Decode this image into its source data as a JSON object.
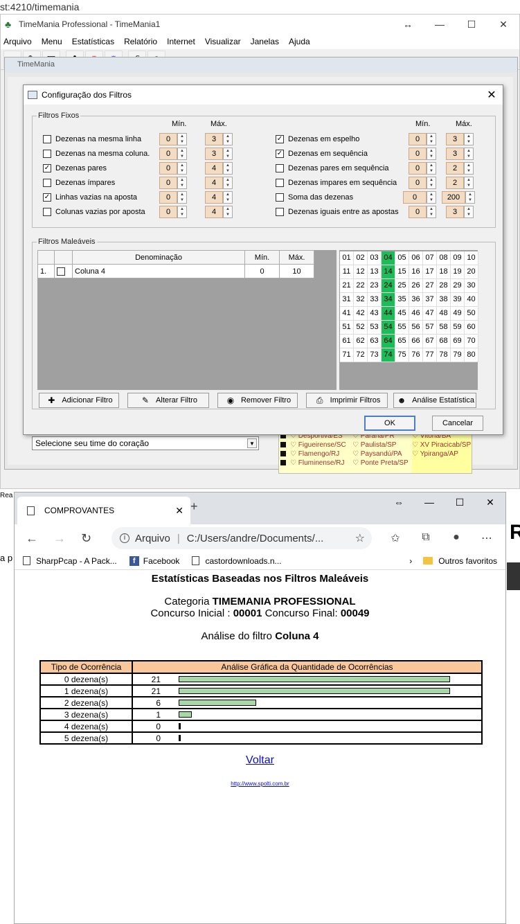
{
  "url_strip": "st:4210/timemania",
  "app": {
    "title": "TimeMania Professional - TimeMania1",
    "menu": [
      "Arquivo",
      "Menu",
      "Estatísticas",
      "Relatório",
      "Internet",
      "Visualizar",
      "Janelas",
      "Ajuda"
    ],
    "mdi_title": "TimeMania",
    "team_select": "Selecione seu time do coração",
    "teams": {
      "col1": [
        "Desportiva/ES",
        "Figueirense/SC",
        "Flamengo/RJ",
        "Fluminense/RJ"
      ],
      "col2": [
        "Paraná/PR",
        "Paulista/SP",
        "Paysandú/PA",
        "Ponte Preta/SP"
      ],
      "col3": [
        "Vitória/BA",
        "XV Piracicab/SP",
        "Ypiranga/AP"
      ]
    }
  },
  "dialog": {
    "title": "Configuração dos Filtros",
    "fixos_legend": "Filtros Fixos",
    "min_label": "Mín.",
    "max_label": "Máx.",
    "left_filters": [
      {
        "label": "Dezenas na mesma linha",
        "checked": false,
        "min": "0",
        "max": "3"
      },
      {
        "label": "Dezenas na mesma coluna.",
        "checked": false,
        "min": "0",
        "max": "3"
      },
      {
        "label": "Dezenas pares",
        "checked": true,
        "min": "0",
        "max": "4"
      },
      {
        "label": "Dezenas ímpares",
        "checked": false,
        "min": "0",
        "max": "4"
      },
      {
        "label": "Linhas vazias na aposta",
        "checked": true,
        "min": "0",
        "max": "4"
      },
      {
        "label": "Colunas vazias por aposta",
        "checked": false,
        "min": "0",
        "max": "4"
      }
    ],
    "right_filters": [
      {
        "label": "Dezenas em espelho",
        "checked": true,
        "min": "0",
        "max": "3"
      },
      {
        "label": "Dezenas em  sequência",
        "checked": true,
        "min": "0",
        "max": "3"
      },
      {
        "label": "Dezenas pares em sequência",
        "checked": false,
        "min": "0",
        "max": "2"
      },
      {
        "label": "Dezenas  impares em sequência",
        "checked": false,
        "min": "0",
        "max": "2"
      },
      {
        "label": "Soma das dezenas",
        "checked": false,
        "min": "0",
        "max": "200"
      },
      {
        "label": "Dezenas iguais entre as apostas",
        "checked": false,
        "min": "0",
        "max": "3"
      }
    ],
    "maleaveis_legend": "Filtros Maleáveis",
    "table_headers": {
      "denom": "Denominação",
      "min": "Mín.",
      "max": "Máx."
    },
    "table_rows": [
      {
        "idx": "1.",
        "name": "Coluna 4",
        "min": "0",
        "max": "10"
      }
    ],
    "highlighted": [
      "04",
      "14",
      "24",
      "34",
      "44",
      "54",
      "64",
      "74"
    ],
    "numbers": [
      "01",
      "02",
      "03",
      "04",
      "05",
      "06",
      "07",
      "08",
      "09",
      "10",
      "11",
      "12",
      "13",
      "14",
      "15",
      "16",
      "17",
      "18",
      "19",
      "20",
      "21",
      "22",
      "23",
      "24",
      "25",
      "26",
      "27",
      "28",
      "29",
      "30",
      "31",
      "32",
      "33",
      "34",
      "35",
      "36",
      "37",
      "38",
      "39",
      "40",
      "41",
      "42",
      "43",
      "44",
      "45",
      "46",
      "47",
      "48",
      "49",
      "50",
      "51",
      "52",
      "53",
      "54",
      "55",
      "56",
      "57",
      "58",
      "59",
      "60",
      "61",
      "62",
      "63",
      "64",
      "65",
      "66",
      "67",
      "68",
      "69",
      "70",
      "71",
      "72",
      "73",
      "74",
      "75",
      "76",
      "77",
      "78",
      "79",
      "80"
    ],
    "buttons": {
      "add": "Adicionar Filtro",
      "edit": "Alterar Filtro",
      "remove": "Remover Filtro",
      "print": "Imprimir Filtros",
      "stats": "Análise Estatística",
      "ok": "OK",
      "cancel": "Cancelar"
    }
  },
  "browser": {
    "tab_title": "COMPROVANTES",
    "url_label": "Arquivo",
    "url": "C:/Users/andre/Documents/...",
    "bookmarks": [
      "SharpPcap - A Pack...",
      "Facebook",
      "castordownloads.n..."
    ],
    "other_bookmarks": "Outros favoritos",
    "report": {
      "heading": "Estatísticas Baseadas nos Filtros Maleáveis",
      "categoria_label": "Categoria",
      "categoria": "TIMEMANIA PROFESSIONAL",
      "inicial_label": "Concurso Inicial :",
      "inicial": "00001",
      "final_label": "Concurso Final:",
      "final": "00049",
      "analise_label": "Análise do filtro",
      "analise": "Coluna 4",
      "col_tipo": "Tipo de Ocorrência",
      "col_grafico": "Análise Gráfica da Quantidade de Ocorrências",
      "rows": [
        {
          "tipo": "0 dezena(s)",
          "qtd": 21
        },
        {
          "tipo": "1 dezena(s)",
          "qtd": 21
        },
        {
          "tipo": "2 dezena(s)",
          "qtd": 6
        },
        {
          "tipo": "3 dezena(s)",
          "qtd": 1
        },
        {
          "tipo": "4 dezena(s)",
          "qtd": 0
        },
        {
          "tipo": "5 dezena(s)",
          "qtd": 0
        }
      ],
      "voltar": "Voltar",
      "site": "http://www.spolti.com.br"
    }
  },
  "background": {
    "rea": "Rea",
    "a": "a p",
    "R": "R"
  }
}
